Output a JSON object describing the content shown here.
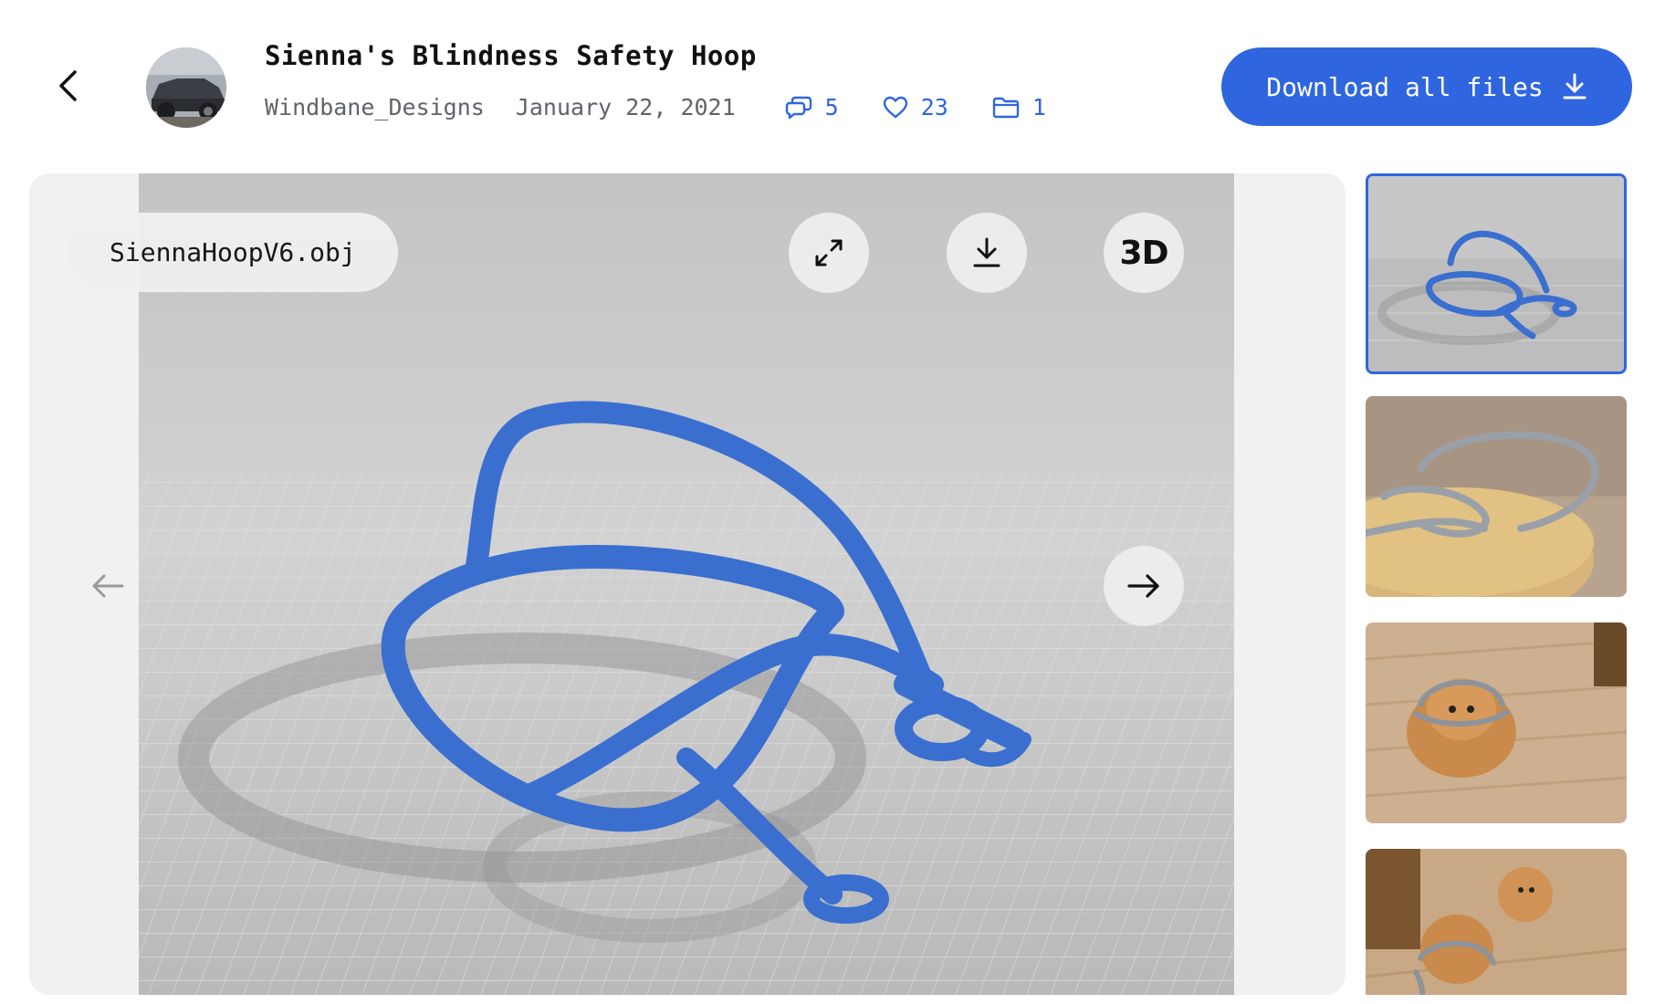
{
  "header": {
    "title": "Sienna's Blindness Safety Hoop",
    "author": "Windbane_Designs",
    "date": "January 22, 2021",
    "stats": {
      "comments": "5",
      "likes": "23",
      "files": "1"
    },
    "download_all_label": "Download all files"
  },
  "viewer": {
    "file_name": "SiennaHoopV6.obj",
    "toggle_3d_label": "3D"
  },
  "colors": {
    "accent": "#2f66e0",
    "model": "#3a6fd0"
  },
  "thumbnails": [
    {
      "name": "3D render",
      "selected": true
    },
    {
      "name": "printed hoop on table",
      "selected": false
    },
    {
      "name": "dog wearing hoop",
      "selected": false
    },
    {
      "name": "two dogs",
      "selected": false
    }
  ]
}
